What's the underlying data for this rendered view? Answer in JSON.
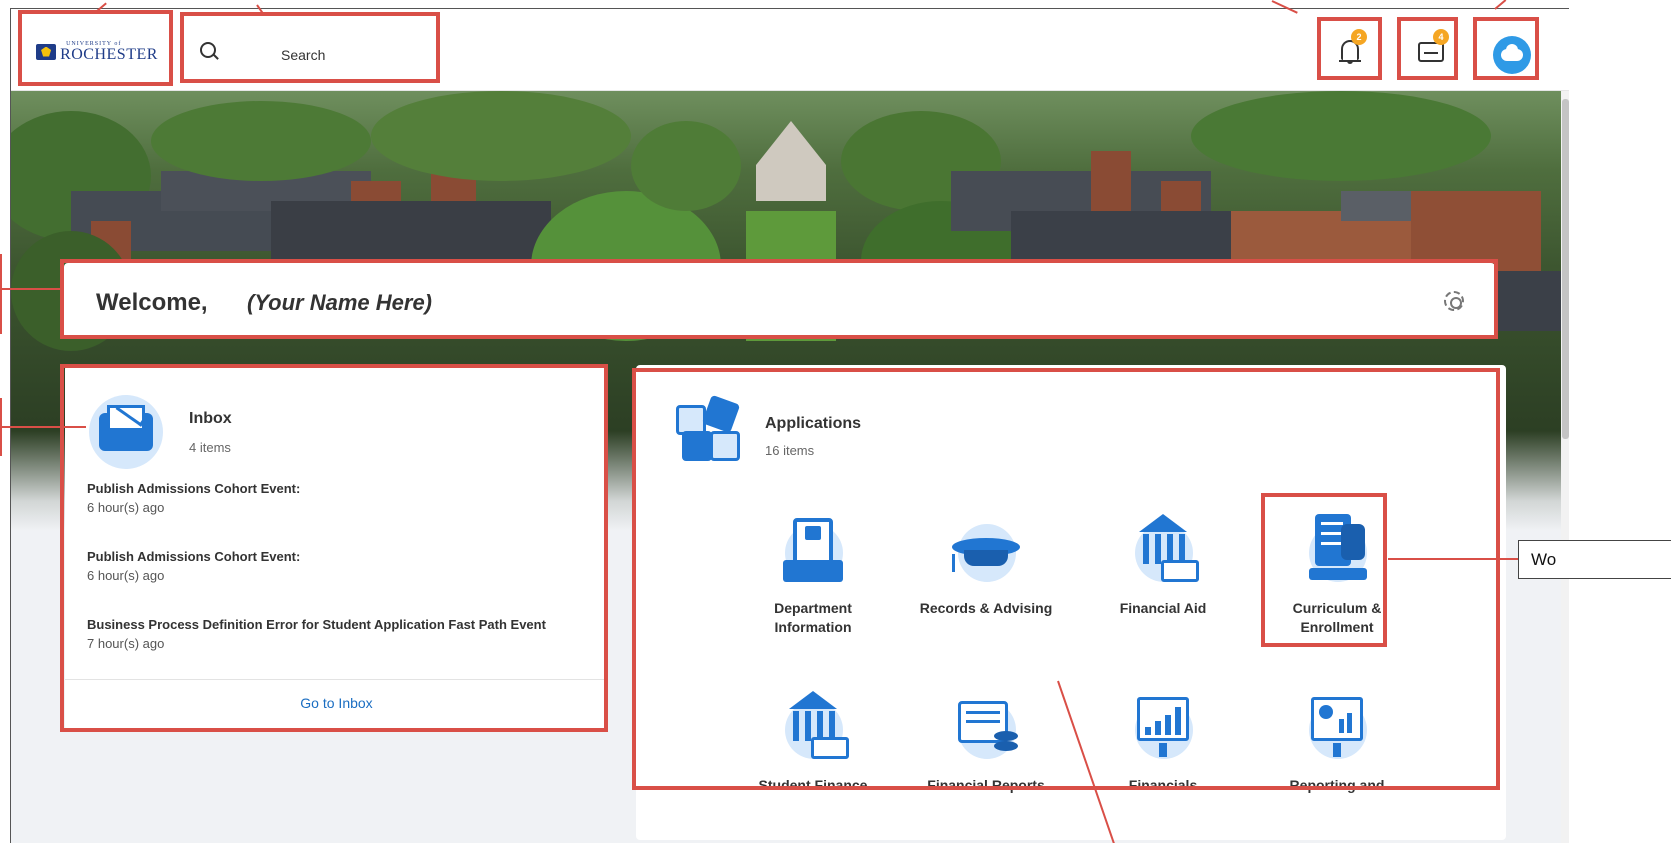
{
  "header": {
    "logo": {
      "line1": "UNIVERSITY of",
      "line2": "ROCHESTER"
    },
    "search_placeholder": "Search",
    "notifications_badge": "2",
    "inbox_badge": "4"
  },
  "welcome": {
    "greeting": "Welcome,",
    "name": "(Your Name Here)"
  },
  "inbox": {
    "title": "Inbox",
    "count": "4 items",
    "items": [
      {
        "title": "Publish Admissions Cohort Event:",
        "time": "6 hour(s) ago"
      },
      {
        "title": "Publish Admissions Cohort Event:",
        "time": "6 hour(s) ago"
      },
      {
        "title": "Business Process Definition Error for Student Application Fast Path Event",
        "time": "7 hour(s) ago"
      }
    ],
    "link": "Go to Inbox"
  },
  "applications": {
    "title": "Applications",
    "count": "16 items",
    "tiles": [
      {
        "label": "Department Information",
        "icon": "department-information-icon"
      },
      {
        "label": "Records & Advising",
        "icon": "graduation-cap-icon"
      },
      {
        "label": "Financial Aid",
        "icon": "bank-icon"
      },
      {
        "label": "Curriculum & Enrollment",
        "icon": "curriculum-checklist-icon"
      },
      {
        "label": "Student Finance",
        "icon": "bank-icon"
      },
      {
        "label": "Financial Reports",
        "icon": "report-coins-icon"
      },
      {
        "label": "Financials",
        "icon": "line-chart-icon"
      },
      {
        "label": "Reporting and",
        "icon": "pie-chart-icon"
      }
    ]
  },
  "annotations": {
    "side_label_fragment": "Wo"
  },
  "colors": {
    "accent_blue": "#2176d2",
    "badge_orange": "#f5a623",
    "annotation_red": "#d94f47"
  }
}
